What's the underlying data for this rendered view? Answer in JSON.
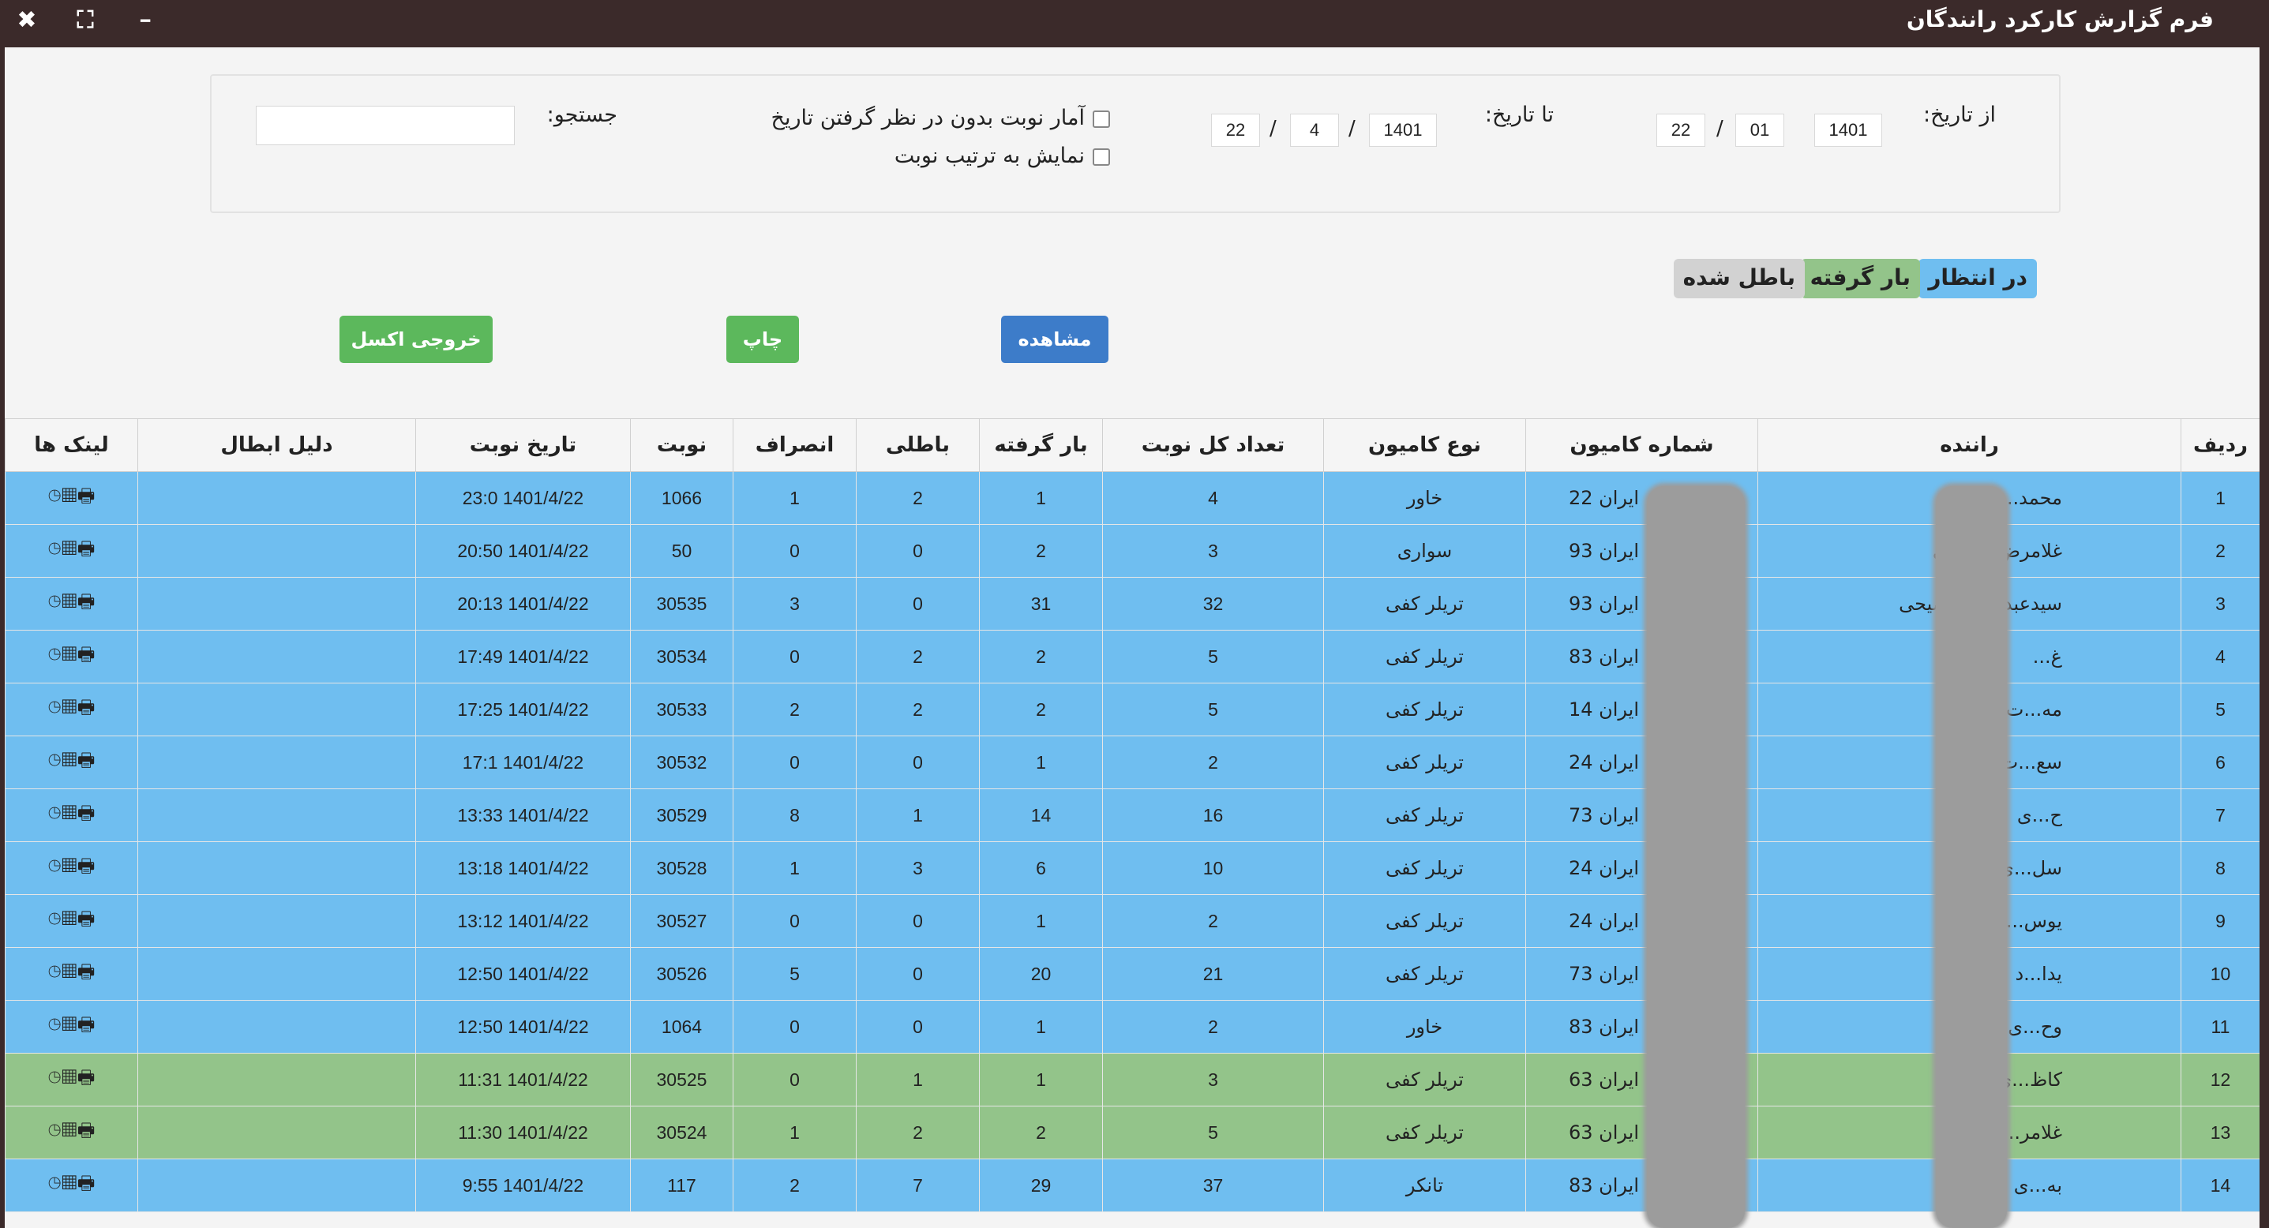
{
  "window": {
    "title": "فرم گزارش کارکرد رانندگان",
    "close": "✖",
    "maximize": "⛶",
    "minimize": "━"
  },
  "filters": {
    "from_label": "از تاریخ:",
    "from_day": "22",
    "from_month": "01",
    "from_year": "1401",
    "to_label": "تا تاریخ:",
    "to_day": "22",
    "to_month": "4",
    "to_year": "1401",
    "sep": "/",
    "check_stats": "آمار نوبت بدون در نظر گرفتن تاریخ",
    "check_order": "نمایش به ترتیب نوبت",
    "search_label": "جستجو:",
    "search_value": ""
  },
  "legend": {
    "waiting": "در انتظار",
    "loaded": "بار گرفته",
    "cancelled": "باطل شده"
  },
  "buttons": {
    "view": "مشاهده",
    "print": "چاپ",
    "excel": "خروجی اکسل"
  },
  "colors": {
    "titlebar": "#3b2a2a",
    "row_waiting": "#6fbef0",
    "row_loaded": "#93c48a",
    "chip_waiting": "#6fbef0",
    "chip_loaded": "#93c48a",
    "chip_cancelled": "#d2d2d2",
    "btn_view": "#3d7cc9",
    "btn_green": "#5cb85c"
  },
  "table": {
    "headers": [
      "ردیف",
      "راننده",
      "شماره کامیون",
      "نوع کامیون",
      "تعداد کل نوبت",
      "بار گرفته",
      "باطلی",
      "انصراف",
      "نوبت",
      "تاریخ نوبت",
      "دلیل ابطال",
      "لینک ها"
    ],
    "link_icons": "🖶▦◷",
    "rows": [
      {
        "status": "blue",
        "num": "1",
        "driver": "محمد...لویی",
        "plate": "ایران 22",
        "type": "خاور",
        "total": "4",
        "loaded": "1",
        "void": "2",
        "cancel": "1",
        "turn": "1066",
        "date": "1401/4/22 23:0",
        "reason": ""
      },
      {
        "status": "blue",
        "num": "2",
        "driver": "غلامرض...دالینی",
        "plate": "ایران 93",
        "type": "سواری",
        "total": "3",
        "loaded": "2",
        "void": "0",
        "cancel": "0",
        "turn": "50",
        "date": "1401/4/22 20:50",
        "reason": ""
      },
      {
        "status": "blue",
        "num": "3",
        "driver": "سیدعبدالر... فصیحی",
        "plate": "ایران 93",
        "type": "تریلر کفی",
        "total": "32",
        "loaded": "31",
        "void": "0",
        "cancel": "3",
        "turn": "30535",
        "date": "1401/4/22 20:13",
        "reason": ""
      },
      {
        "status": "blue",
        "num": "4",
        "driver": "غ...",
        "plate": "ایران 83",
        "type": "تریلر کفی",
        "total": "5",
        "loaded": "2",
        "void": "2",
        "cancel": "0",
        "turn": "30534",
        "date": "1401/4/22 17:49",
        "reason": ""
      },
      {
        "status": "blue",
        "num": "5",
        "driver": "مه...ت",
        "plate": "ایران 14",
        "type": "تریلر کفی",
        "total": "5",
        "loaded": "2",
        "void": "2",
        "cancel": "2",
        "turn": "30533",
        "date": "1401/4/22 17:25",
        "reason": ""
      },
      {
        "status": "blue",
        "num": "6",
        "driver": "سع...ت",
        "plate": "ایران 24",
        "type": "تریلر کفی",
        "total": "2",
        "loaded": "1",
        "void": "0",
        "cancel": "0",
        "turn": "30532",
        "date": "1401/4/22 17:1",
        "reason": ""
      },
      {
        "status": "blue",
        "num": "7",
        "driver": "ح...ی",
        "plate": "ایران 73",
        "type": "تریلر کفی",
        "total": "16",
        "loaded": "14",
        "void": "1",
        "cancel": "8",
        "turn": "30529",
        "date": "1401/4/22 13:33",
        "reason": ""
      },
      {
        "status": "blue",
        "num": "8",
        "driver": "سل...ی",
        "plate": "ایران 24",
        "type": "تریلر کفی",
        "total": "10",
        "loaded": "6",
        "void": "3",
        "cancel": "1",
        "turn": "30528",
        "date": "1401/4/22 13:18",
        "reason": ""
      },
      {
        "status": "blue",
        "num": "9",
        "driver": "یوس...پور",
        "plate": "ایران 24",
        "type": "تریلر کفی",
        "total": "2",
        "loaded": "1",
        "void": "0",
        "cancel": "0",
        "turn": "30527",
        "date": "1401/4/22 13:12",
        "reason": ""
      },
      {
        "status": "blue",
        "num": "10",
        "driver": "یدا...د",
        "plate": "ایران 73",
        "type": "تریلر کفی",
        "total": "21",
        "loaded": "20",
        "void": "0",
        "cancel": "5",
        "turn": "30526",
        "date": "1401/4/22 12:50",
        "reason": ""
      },
      {
        "status": "blue",
        "num": "11",
        "driver": "وح...ی",
        "plate": "ایران 83",
        "type": "خاور",
        "total": "2",
        "loaded": "1",
        "void": "0",
        "cancel": "0",
        "turn": "1064",
        "date": "1401/4/22 12:50",
        "reason": ""
      },
      {
        "status": "green",
        "num": "12",
        "driver": "کاظ...ی",
        "plate": "ایران 63",
        "type": "تریلر کفی",
        "total": "3",
        "loaded": "1",
        "void": "1",
        "cancel": "0",
        "turn": "30525",
        "date": "1401/4/22 11:31",
        "reason": ""
      },
      {
        "status": "green",
        "num": "13",
        "driver": "غلامر...ش1",
        "plate": "ایران 63",
        "type": "تریلر کفی",
        "total": "5",
        "loaded": "2",
        "void": "2",
        "cancel": "1",
        "turn": "30524",
        "date": "1401/4/22 11:30",
        "reason": ""
      },
      {
        "status": "blue",
        "num": "14",
        "driver": "به...ی",
        "plate": "ایران 83",
        "type": "تانکر",
        "total": "37",
        "loaded": "29",
        "void": "7",
        "cancel": "2",
        "turn": "117",
        "date": "1401/4/22 9:55",
        "reason": ""
      }
    ]
  }
}
